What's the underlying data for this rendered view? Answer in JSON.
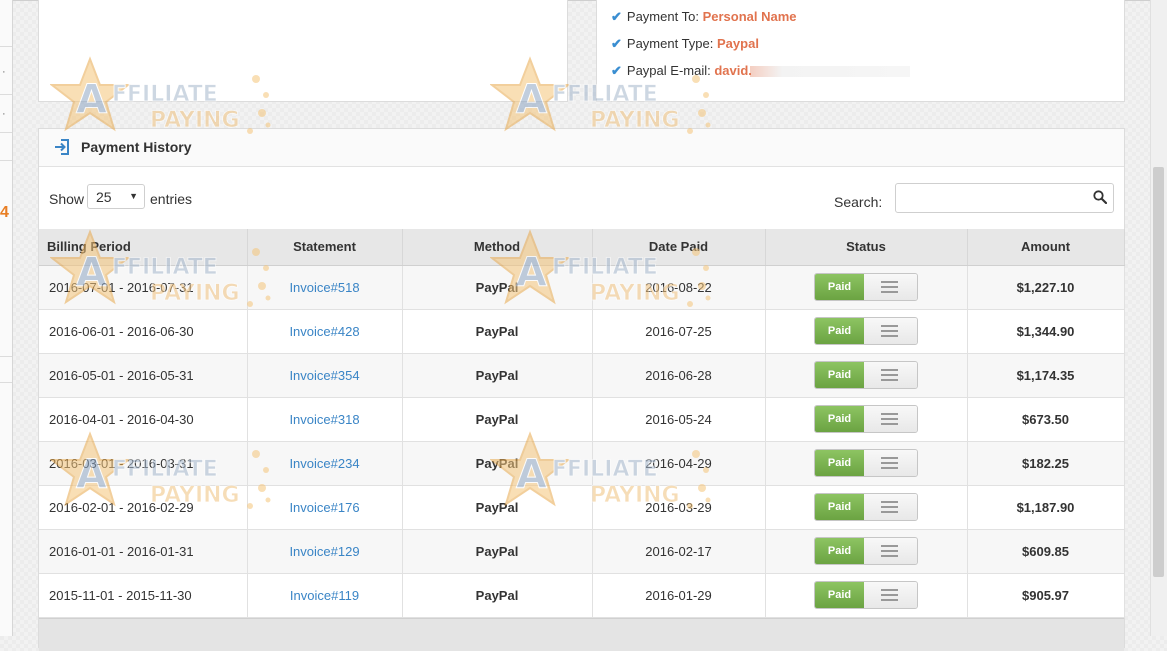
{
  "payment_info": {
    "payment_to_label": "Payment To:",
    "payment_to_value": "Personal Name",
    "payment_type_label": "Payment Type:",
    "payment_type_value": "Paypal",
    "paypal_email_label": "Paypal E-mail:",
    "paypal_email_value": "david."
  },
  "payment_history": {
    "title": "Payment History",
    "show_label": "Show",
    "entries_value": "25",
    "entries_label": "entries",
    "search_label": "Search:",
    "columns": [
      "Billing Period",
      "Statement",
      "Method",
      "Date Paid",
      "Status",
      "Amount"
    ],
    "rows": [
      {
        "period": "2016-07-01 - 2016-07-31",
        "statement": "Invoice#518",
        "method": "PayPal",
        "date_paid": "2016-08-22",
        "status": "Paid",
        "amount": "$1,227.10"
      },
      {
        "period": "2016-06-01 - 2016-06-30",
        "statement": "Invoice#428",
        "method": "PayPal",
        "date_paid": "2016-07-25",
        "status": "Paid",
        "amount": "$1,344.90"
      },
      {
        "period": "2016-05-01 - 2016-05-31",
        "statement": "Invoice#354",
        "method": "PayPal",
        "date_paid": "2016-06-28",
        "status": "Paid",
        "amount": "$1,174.35"
      },
      {
        "period": "2016-04-01 - 2016-04-30",
        "statement": "Invoice#318",
        "method": "PayPal",
        "date_paid": "2016-05-24",
        "status": "Paid",
        "amount": "$673.50"
      },
      {
        "period": "2016-03-01 - 2016-03-31",
        "statement": "Invoice#234",
        "method": "PayPal",
        "date_paid": "2016-04-29",
        "status": "Paid",
        "amount": "$182.25"
      },
      {
        "period": "2016-02-01 - 2016-02-29",
        "statement": "Invoice#176",
        "method": "PayPal",
        "date_paid": "2016-03-29",
        "status": "Paid",
        "amount": "$1,187.90"
      },
      {
        "period": "2016-01-01 - 2016-01-31",
        "statement": "Invoice#129",
        "method": "PayPal",
        "date_paid": "2016-02-17",
        "status": "Paid",
        "amount": "$609.85"
      },
      {
        "period": "2015-11-01 - 2015-11-30",
        "statement": "Invoice#119",
        "method": "PayPal",
        "date_paid": "2016-01-29",
        "status": "Paid",
        "amount": "$905.97"
      }
    ]
  },
  "watermark": {
    "line1": "AFFILIATE",
    "line2": "PAYING",
    "letter": "A"
  },
  "colors": {
    "accent_orange": "#e1734e",
    "link_blue": "#3a85c6",
    "toggle_green": "#7cb450"
  }
}
